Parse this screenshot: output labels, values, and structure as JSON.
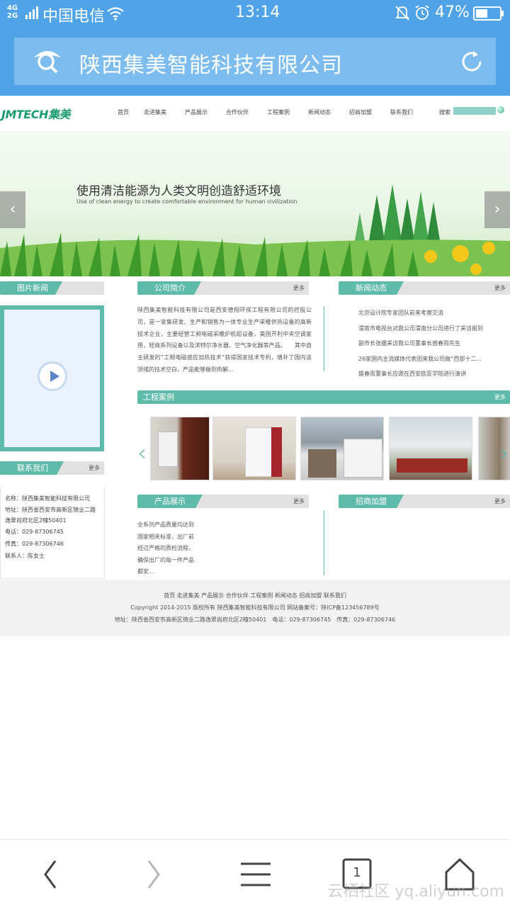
{
  "status_bar": {
    "network": "4G 2G",
    "carrier": "中国电信",
    "time": "13:14",
    "battery_percent": "47%",
    "icons": [
      "signal-icon",
      "wifi-icon",
      "silent-bell-icon",
      "alarm-icon",
      "battery-icon"
    ]
  },
  "browser": {
    "page_title": "陕西集美智能科技有限公司",
    "reader_icon": "reader-mode-icon",
    "refresh_icon": "refresh-icon"
  },
  "site": {
    "logo": "JMTECH集美",
    "nav": [
      "首页",
      "走进集美",
      "产品展示",
      "合作伙伴",
      "工程案例",
      "新闻动态",
      "招商加盟",
      "联系我们"
    ],
    "search_label": "搜索",
    "banner": {
      "slogan": "使用清洁能源为人类文明创造舒适环境",
      "slogan_en": "Use of clean energy to create comfortable environment for human civilization"
    },
    "more_label": "更多",
    "sections": {
      "photo_news": "图片新闻",
      "company_intro": "公司简介",
      "news": "新闻动态",
      "cases": "工程案例",
      "contact": "联系我们",
      "products": "产品展示",
      "franchise": "招商加盟"
    },
    "intro_text": "陕西集美智能科技有限公司是西安德翔环保工程有限公司的控股公司，是一家集研发、生产和销售为一体专业生产采暖供热设备的高新技术企业，主要经营工频电磁采暖炉机组设备，美国开利中央空调家用，轻商系列设备以及滨特尔净水器、空气净化器等产品。　　其中自主研发的“工频电磁感应加热技术”获得国家技术专利，填补了国内该领域的技术空白，产品能够做到热解...",
    "news_items": [
      "北京设计院专家团队前来考察交流",
      "渭南市电视台对我公司渭南分公司进行了采访报到",
      "副市长张援采访我公司董事长感春雨先生",
      "26家国内主流媒体代表团来我公司做“西部十二...",
      "盛春雨董事长应邀在西安欧亚学院进行演讲"
    ],
    "contact": {
      "name": "名称：陕西集美智能科技有限公司",
      "address": "地址：陕西省西安市高新区锦业二路逸翠尚府北区2幢50401",
      "phone": "电话：029-87306745",
      "fax": "传真：029-87306746",
      "person": "联系人：陈女士"
    },
    "products_text": "全系列产品质量均达到国家相关标准，出厂前经过严格的质检流程，确保出厂的每一件产品都安...",
    "footer": {
      "links": "首页 走进集美 产品展示 合作伙伴 工程案例 新闻动态 招商加盟 联系我们",
      "copyright": "Copyright 2014-2015 版权所有 陕西集美智能科技有限公司 网站备案号：陕ICP备123456789号",
      "address": "地址：陕西省西安市高新区锦业二路逸翠尚府北区2幢50401　电话：029-87306745　传真：029-87306746"
    }
  },
  "toolbar": {
    "icons": [
      "back-icon",
      "forward-icon",
      "menu-icon",
      "tabs-icon",
      "home-icon"
    ],
    "tab_count": "1"
  },
  "watermark": "云栖社区 yq.aliyun.com",
  "colors": {
    "browser_blue": "#4fa3e6",
    "teal": "#5fbba9",
    "logo_green": "#1a9b6e"
  }
}
